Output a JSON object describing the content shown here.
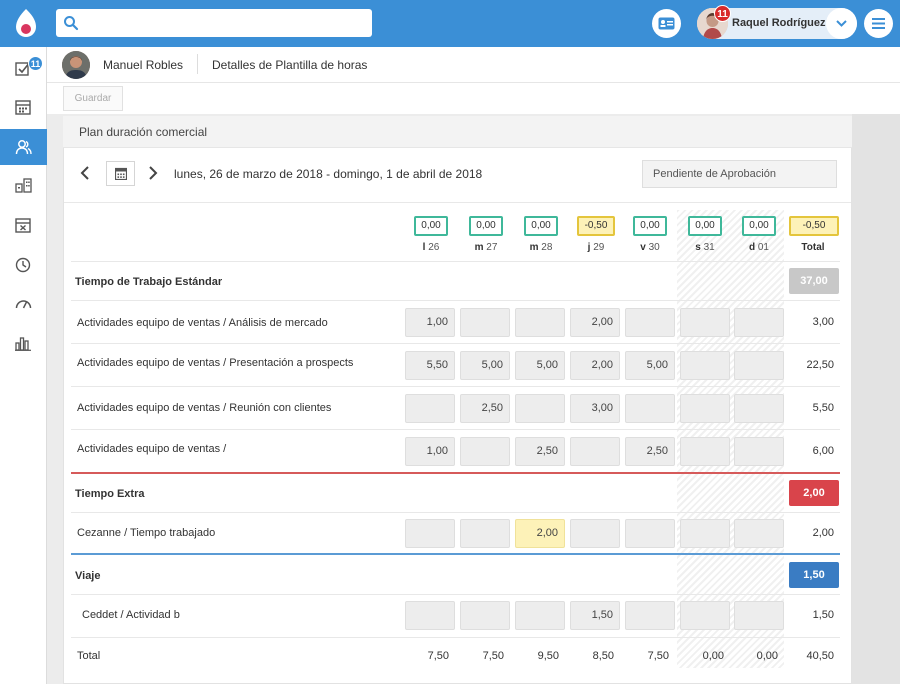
{
  "topbar": {
    "user_name": "Raquel Rodríguez",
    "notifications": "11",
    "accent": "#3b8fd6",
    "icons": [
      "logo-icon",
      "search-icon",
      "id-card-icon",
      "chevron-down-icon",
      "menu-icon"
    ]
  },
  "sidebar": {
    "badge": "11",
    "icons": [
      "tasks-icon",
      "calendar-icon",
      "people-icon",
      "buildings-icon",
      "calendar-x-icon",
      "clock-icon",
      "gauge-icon",
      "bar-chart-icon"
    ]
  },
  "header": {
    "person_name": "Manuel Robles",
    "detail": "Detalles de Plantilla de horas",
    "save_label": "Guardar"
  },
  "panel": {
    "title": "Plan duración comercial",
    "date_range": "lunes, 26 de marzo de 2018 - domingo, 1 de abril de 2018",
    "status": "Pendiente de Aprobación"
  },
  "days": [
    {
      "abbr": "l",
      "num": "26",
      "total": "0,00"
    },
    {
      "abbr": "m",
      "num": "27",
      "total": "0,00"
    },
    {
      "abbr": "m",
      "num": "28",
      "total": "0,00"
    },
    {
      "abbr": "j",
      "num": "29",
      "total": "-0,50"
    },
    {
      "abbr": "v",
      "num": "30",
      "total": "0,00"
    },
    {
      "abbr": "s",
      "num": "31",
      "total": "0,00"
    },
    {
      "abbr": "d",
      "num": "01",
      "total": "0,00"
    }
  ],
  "week_total": "-0,50",
  "total_label": "Total",
  "sections": {
    "standard": {
      "title": "Tiempo de Trabajo Estándar",
      "total": "37,00",
      "color": "#c8c8c8",
      "rows": [
        {
          "label": "Actividades equipo de ventas / Análisis de mercado",
          "cells": [
            "1,00",
            "",
            "",
            "2,00",
            "",
            "",
            ""
          ],
          "total": "3,00"
        },
        {
          "label": "Actividades equipo de ventas / Presentación a prospects",
          "cells": [
            "5,50",
            "5,00",
            "5,00",
            "2,00",
            "5,00",
            "",
            ""
          ],
          "total": "22,50"
        },
        {
          "label": "Actividades equipo de ventas / Reunión con clientes",
          "cells": [
            "",
            "2,50",
            "",
            "3,00",
            "",
            "",
            ""
          ],
          "total": "5,50"
        },
        {
          "label": "Actividades equipo de ventas /",
          "cells": [
            "1,00",
            "",
            "2,50",
            "",
            "2,50",
            "",
            ""
          ],
          "total": "6,00"
        }
      ]
    },
    "extra": {
      "title": "Tiempo Extra",
      "total": "2,00",
      "color": "#d9444b",
      "rows": [
        {
          "label": "Cezanne / Tiempo trabajado",
          "cells": [
            "",
            "",
            "2,00",
            "",
            "",
            "",
            ""
          ],
          "total": "2,00"
        }
      ]
    },
    "travel": {
      "title": "Viaje",
      "total": "1,50",
      "color": "#3a7cc3",
      "rows": [
        {
          "label": "Ceddet / Actividad b",
          "cells": [
            "",
            "",
            "",
            "1,50",
            "",
            "",
            ""
          ],
          "total": "1,50"
        }
      ]
    }
  },
  "footer": {
    "label": "Total",
    "values": [
      "7,50",
      "7,50",
      "9,50",
      "8,50",
      "7,50",
      "0,00",
      "0,00"
    ],
    "total": "40,50"
  }
}
